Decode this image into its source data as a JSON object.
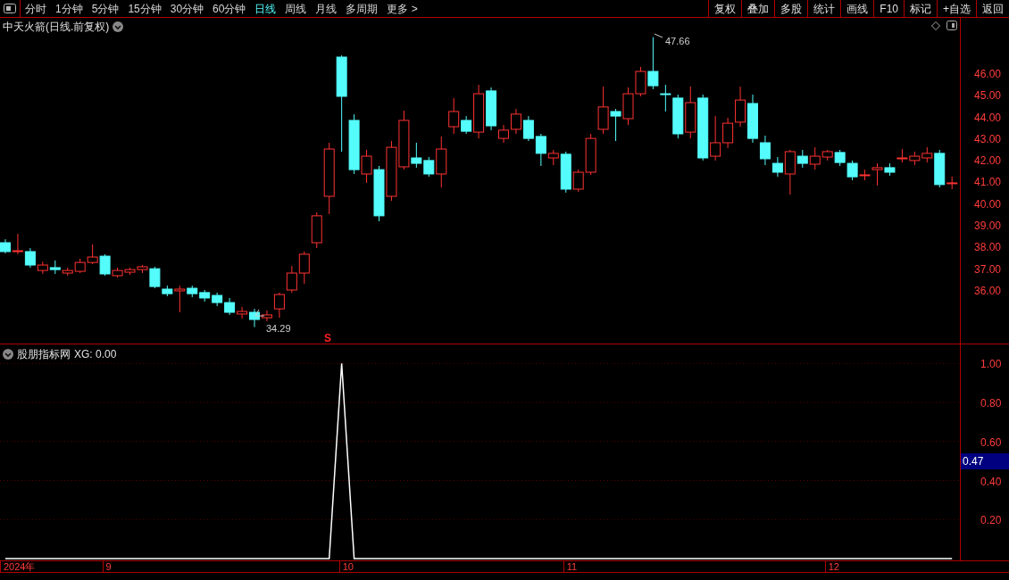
{
  "toolbar": {
    "periods": [
      {
        "label": "分时",
        "selected": false
      },
      {
        "label": "1分钟",
        "selected": false
      },
      {
        "label": "5分钟",
        "selected": false
      },
      {
        "label": "15分钟",
        "selected": false
      },
      {
        "label": "30分钟",
        "selected": false
      },
      {
        "label": "60分钟",
        "selected": false
      },
      {
        "label": "日线",
        "selected": true
      },
      {
        "label": "周线",
        "selected": false
      },
      {
        "label": "月线",
        "selected": false
      },
      {
        "label": "多周期",
        "selected": false
      },
      {
        "label": "更多 >",
        "selected": false
      }
    ],
    "buttons": [
      "复权",
      "叠加",
      "多股",
      "统计",
      "画线",
      "F10",
      "标记",
      "+自选",
      "返回"
    ]
  },
  "price_chart": {
    "title": "中天火箭(日线.前复权)",
    "high_label": "47.66",
    "low_label": "34.29",
    "signal_mark": "S",
    "chart_data": {
      "type": "candlestick",
      "ylim": [
        33.53,
        48.55
      ],
      "ohlc": [
        [
          38.18,
          38.34,
          37.69,
          37.77
        ],
        [
          37.77,
          38.59,
          37.65,
          37.81
        ],
        [
          37.77,
          37.93,
          37.03,
          37.15
        ],
        [
          36.9,
          37.31,
          36.74,
          37.15
        ],
        [
          37.03,
          37.36,
          36.74,
          36.94
        ],
        [
          36.78,
          37.03,
          36.66,
          36.9
        ],
        [
          36.86,
          37.44,
          36.78,
          37.27
        ],
        [
          37.27,
          38.1,
          37.19,
          37.52
        ],
        [
          37.56,
          37.65,
          36.66,
          36.74
        ],
        [
          36.66,
          37.03,
          36.57,
          36.9
        ],
        [
          36.82,
          37.03,
          36.7,
          36.94
        ],
        [
          36.94,
          37.15,
          36.78,
          37.07
        ],
        [
          36.98,
          37.07,
          36.08,
          36.16
        ],
        [
          36.04,
          36.2,
          35.71,
          35.83
        ],
        [
          35.96,
          36.2,
          34.97,
          36.04
        ],
        [
          36.08,
          36.2,
          35.67,
          35.83
        ],
        [
          35.88,
          36.0,
          35.46,
          35.63
        ],
        [
          35.75,
          35.88,
          35.26,
          35.42
        ],
        [
          35.42,
          35.63,
          34.85,
          34.97
        ],
        [
          34.89,
          35.22,
          34.68,
          35.01
        ],
        [
          34.97,
          35.13,
          34.29,
          34.64
        ],
        [
          34.72,
          35.05,
          34.56,
          34.85
        ],
        [
          35.13,
          35.88,
          34.72,
          35.79
        ],
        [
          36.0,
          37.11,
          35.88,
          36.78
        ],
        [
          36.78,
          37.77,
          36.29,
          37.65
        ],
        [
          38.18,
          39.58,
          37.93,
          39.42
        ],
        [
          40.32,
          42.79,
          39.5,
          42.5
        ],
        [
          46.74,
          46.82,
          42.38,
          44.93
        ],
        [
          43.82,
          44.1,
          41.35,
          41.55
        ],
        [
          41.35,
          42.46,
          40.94,
          42.17
        ],
        [
          41.55,
          41.72,
          39.17,
          39.42
        ],
        [
          40.32,
          42.87,
          40.11,
          42.58
        ],
        [
          41.68,
          44.27,
          41.55,
          43.82
        ],
        [
          42.09,
          42.79,
          41.64,
          41.84
        ],
        [
          41.97,
          42.13,
          41.22,
          41.35
        ],
        [
          41.35,
          43.08,
          40.73,
          42.5
        ],
        [
          43.53,
          44.85,
          43.2,
          44.23
        ],
        [
          43.82,
          44.02,
          43.2,
          43.32
        ],
        [
          43.28,
          45.46,
          42.99,
          45.05
        ],
        [
          45.18,
          45.34,
          43.37,
          43.57
        ],
        [
          42.99,
          43.61,
          42.79,
          43.37
        ],
        [
          43.41,
          44.35,
          43.2,
          44.11
        ],
        [
          43.82,
          44.02,
          42.87,
          42.99
        ],
        [
          43.08,
          43.2,
          41.72,
          42.3
        ],
        [
          42.09,
          42.46,
          41.76,
          42.3
        ],
        [
          42.26,
          42.38,
          40.49,
          40.65
        ],
        [
          40.65,
          41.55,
          40.53,
          41.43
        ],
        [
          41.43,
          43.2,
          41.31,
          42.99
        ],
        [
          43.41,
          45.38,
          43.2,
          44.44
        ],
        [
          44.23,
          44.35,
          42.87,
          44.02
        ],
        [
          43.9,
          45.34,
          43.61,
          45.05
        ],
        [
          45.05,
          46.29,
          44.93,
          46.08
        ],
        [
          46.08,
          47.66,
          45.26,
          45.42
        ],
        [
          45.05,
          45.46,
          44.23,
          45.01
        ],
        [
          44.85,
          45.01,
          42.99,
          43.2
        ],
        [
          43.28,
          45.38,
          42.99,
          44.64
        ],
        [
          44.85,
          45.01,
          41.97,
          42.09
        ],
        [
          42.17,
          44.02,
          41.97,
          42.79
        ],
        [
          42.79,
          43.94,
          42.54,
          43.69
        ],
        [
          43.74,
          45.38,
          43.53,
          44.76
        ],
        [
          44.6,
          45.01,
          42.79,
          42.99
        ],
        [
          42.79,
          43.12,
          41.76,
          42.05
        ],
        [
          41.84,
          42.13,
          41.22,
          41.43
        ],
        [
          41.35,
          42.46,
          40.4,
          42.38
        ],
        [
          42.17,
          42.46,
          41.64,
          41.84
        ],
        [
          41.8,
          42.58,
          41.55,
          42.17
        ],
        [
          42.13,
          42.46,
          41.97,
          42.38
        ],
        [
          42.34,
          42.46,
          41.72,
          41.88
        ],
        [
          41.84,
          41.97,
          41.06,
          41.22
        ],
        [
          41.27,
          41.55,
          41.06,
          41.31
        ],
        [
          41.55,
          41.84,
          40.82,
          41.64
        ],
        [
          41.64,
          41.84,
          41.27,
          41.43
        ],
        [
          42.05,
          42.5,
          41.88,
          42.09
        ],
        [
          41.97,
          42.38,
          41.76,
          42.17
        ],
        [
          42.09,
          42.58,
          41.88,
          42.3
        ],
        [
          42.3,
          42.46,
          40.73,
          40.86
        ],
        [
          40.9,
          41.23,
          40.65,
          40.94
        ]
      ],
      "yticks": [
        {
          "value": 46,
          "label": "46.00"
        },
        {
          "value": 45,
          "label": "45.00"
        },
        {
          "value": 44,
          "label": "44.00"
        },
        {
          "value": 43,
          "label": "43.00"
        },
        {
          "value": 42,
          "label": "42.00"
        },
        {
          "value": 41,
          "label": "41.00"
        },
        {
          "value": 40,
          "label": "40.00"
        },
        {
          "value": 39,
          "label": "39.00"
        },
        {
          "value": 38,
          "label": "38.00"
        },
        {
          "value": 37,
          "label": "37.00"
        },
        {
          "value": 36,
          "label": "36.00"
        }
      ]
    }
  },
  "indicator": {
    "title": "股朋指标网",
    "legend_value": ": 0.00",
    "current_value": "0.47",
    "chart_data": {
      "type": "line",
      "ylim": [
        0,
        1
      ],
      "grid": true,
      "yticks": [
        {
          "value": 1,
          "label": "1.00"
        },
        {
          "value": 0.8,
          "label": "0.80"
        },
        {
          "value": 0.6,
          "label": "0.60"
        },
        {
          "value": 0.4,
          "label": "0.40"
        },
        {
          "value": 0.2,
          "label": "0.20"
        }
      ],
      "series": [
        {
          "name": "XG",
          "color": "#ffffff",
          "values": [
            0,
            0,
            0,
            0,
            0,
            0,
            0,
            0,
            0,
            0,
            0,
            0,
            0,
            0,
            0,
            0,
            0,
            0,
            0,
            0,
            0,
            0,
            0,
            0,
            0,
            0,
            0,
            1,
            0,
            0,
            0,
            0,
            0,
            0,
            0,
            0,
            0,
            0,
            0,
            0,
            0,
            0,
            0,
            0,
            0,
            0,
            0,
            0,
            0,
            0,
            0,
            0,
            0,
            0,
            0,
            0,
            0,
            0,
            0,
            0,
            0,
            0,
            0,
            0,
            0,
            0,
            0,
            0,
            0,
            0,
            0,
            0,
            0,
            0,
            0,
            0,
            0
          ]
        }
      ]
    }
  },
  "time_axis": [
    "2024年",
    "9",
    "10",
    "11",
    "12"
  ]
}
